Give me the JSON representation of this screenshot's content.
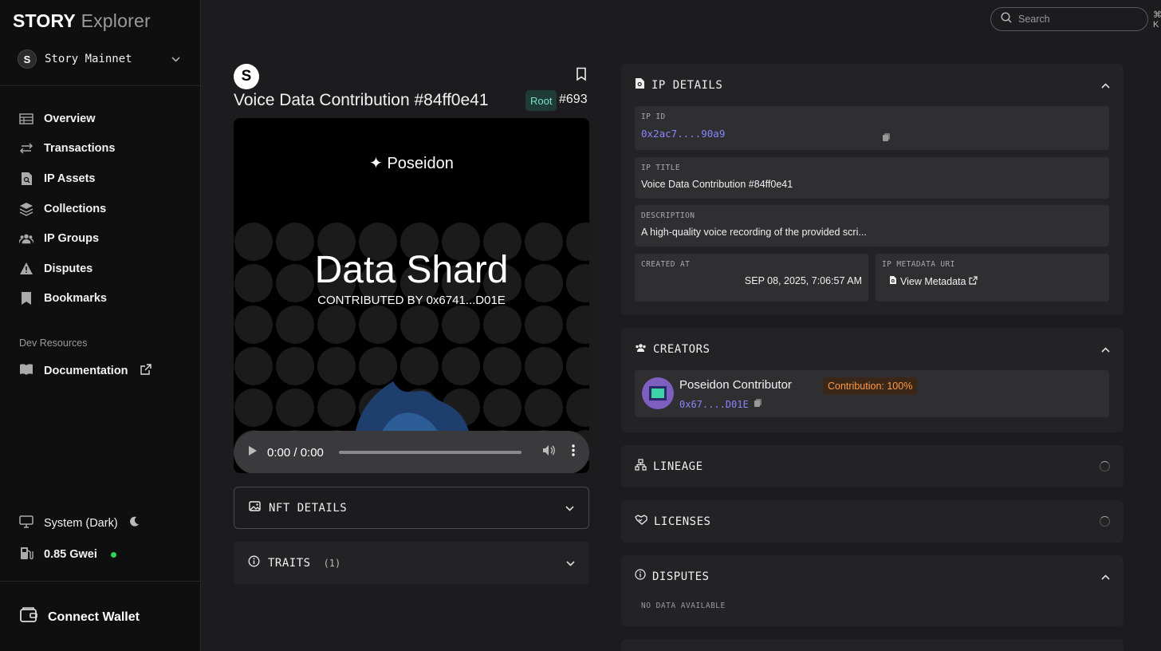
{
  "app": {
    "logo_bold": "STORY",
    "logo_light": "Explorer"
  },
  "network": {
    "icon_letter": "S",
    "name": "Story Mainnet"
  },
  "nav": {
    "items": [
      {
        "label": "Overview",
        "icon": "table-icon"
      },
      {
        "label": "Transactions",
        "icon": "arrows-swap-icon"
      },
      {
        "label": "IP Assets",
        "icon": "file-search-icon"
      },
      {
        "label": "Collections",
        "icon": "layers-icon"
      },
      {
        "label": "IP Groups",
        "icon": "users-icon"
      },
      {
        "label": "Disputes",
        "icon": "warning-icon"
      },
      {
        "label": "Bookmarks",
        "icon": "bookmark-icon"
      }
    ],
    "dev_section_label": "Dev Resources",
    "documentation_label": "Documentation"
  },
  "footer": {
    "theme_label": "System (Dark)",
    "gas_label": "0.85 Gwei",
    "gas_status_color": "#2fd25a",
    "connect_wallet_label": "Connect Wallet"
  },
  "search": {
    "placeholder": "Search",
    "shortcut": "⌘ K"
  },
  "asset": {
    "logo_letter": "S",
    "title": "Voice Data Contribution #84ff0e41",
    "root_badge": "Root",
    "token_id": "#693",
    "media": {
      "brand": "✦ Poseidon",
      "headline": "Data Shard",
      "subline": "CONTRIBUTED BY 0x6741...D01E"
    },
    "audio": {
      "time": "0:00 / 0:00"
    }
  },
  "left_panels": {
    "nft_details": "NFT DETAILS",
    "traits": "TRAITS",
    "traits_count": "(1)"
  },
  "ip_details": {
    "title": "IP DETAILS",
    "ip_id_label": "IP ID",
    "ip_id_value": "0x2ac7....90a9",
    "ip_title_label": "IP TITLE",
    "ip_title_value": "Voice Data Contribution #84ff0e41",
    "description_label": "DESCRIPTION",
    "description_value": "A high-quality voice recording of the provided scri...",
    "created_at_label": "CREATED AT",
    "created_at_value": "SEP 08, 2025, 7:06:57 AM",
    "metadata_uri_label": "IP METADATA URI",
    "metadata_link": "View Metadata"
  },
  "creators": {
    "title": "CREATORS",
    "name": "Poseidon Contributor",
    "contribution": "Contribution: 100%",
    "address": "0x67....D01E"
  },
  "lineage": {
    "title": "LINEAGE"
  },
  "licenses": {
    "title": "LICENSES"
  },
  "disputes": {
    "title": "DISPUTES",
    "empty": "NO DATA AVAILABLE"
  },
  "colors": {
    "accent_link": "#8a84ff",
    "root_badge_text": "#7be0c7",
    "contribution_text": "#ff9a45"
  }
}
